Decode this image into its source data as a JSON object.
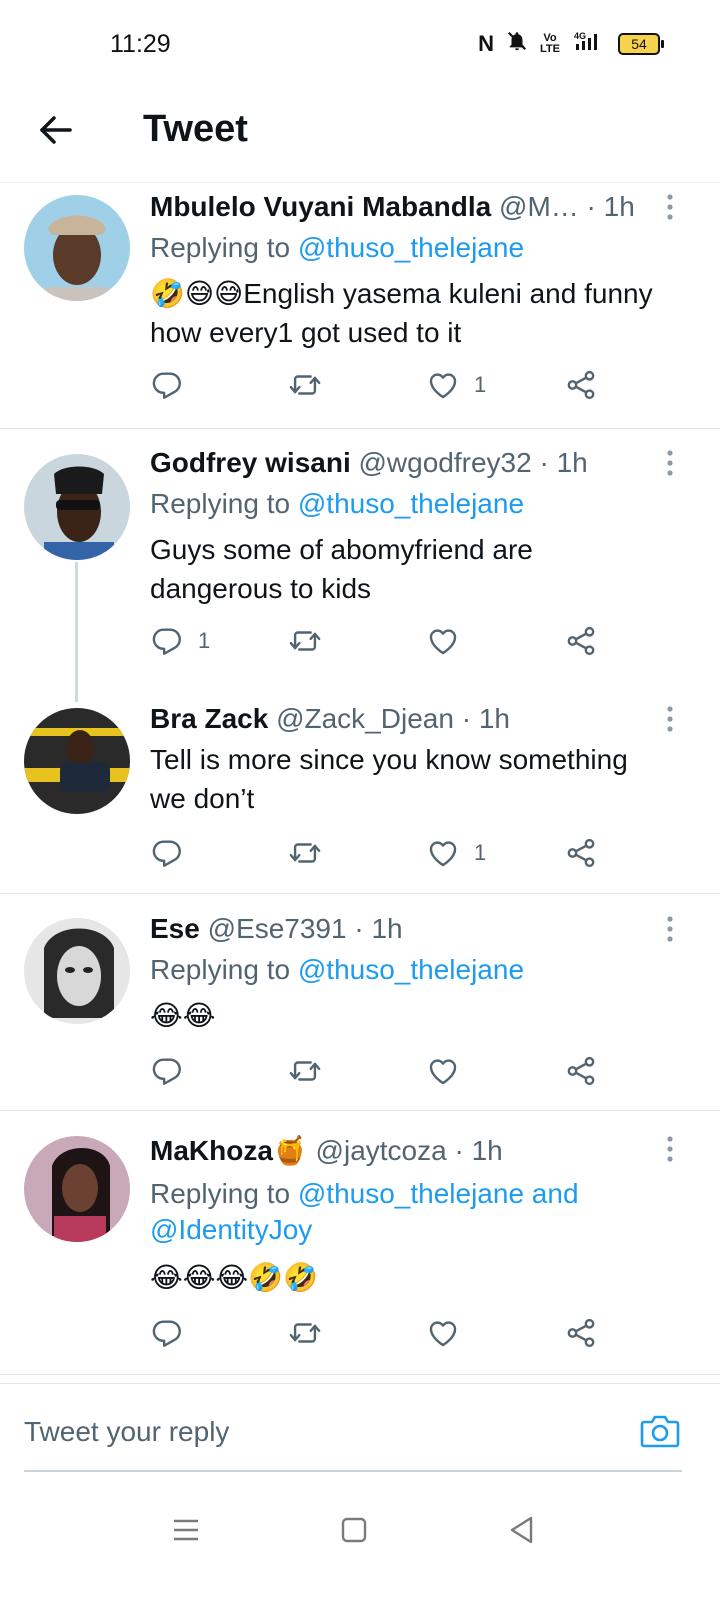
{
  "status": {
    "time": "11:29",
    "nfc": "N",
    "volte": "Vo\nLTE",
    "network": "4G",
    "battery": "54"
  },
  "header": {
    "title": "Tweet"
  },
  "tweets": [
    {
      "name": "Mbulelo Vuyani Mabandla",
      "handle": "@M…",
      "time": "1h",
      "replying_label": "Replying to",
      "mentions": "@thuso_thelejane",
      "text": "🤣😅😅English yasema kuleni and funny how every1 got used to it",
      "reply_count": "",
      "like_count": "1"
    },
    {
      "name": "Godfrey wisani",
      "handle": "@wgodfrey32",
      "time": "1h",
      "replying_label": "Replying to",
      "mentions": "@thuso_thelejane",
      "text": "Guys some of abomyfriend are dangerous to kids",
      "reply_count": "1",
      "like_count": ""
    },
    {
      "name": "Bra Zack",
      "handle": "@Zack_Djean",
      "time": "1h",
      "text": "Tell is more since you know something we don’t",
      "reply_count": "",
      "like_count": "1"
    },
    {
      "name": "Ese",
      "handle": "@Ese7391",
      "time": "1h",
      "replying_label": "Replying to",
      "mentions": "@thuso_thelejane",
      "text": "😂😂",
      "reply_count": "",
      "like_count": ""
    },
    {
      "name": "MaKhoza🍯",
      "handle": "@jaytcoza",
      "time": "1h",
      "replying_label": "Replying to",
      "mentions": "@thuso_thelejane and",
      "mentions2": "@IdentityJoy",
      "text": "😂😂😂🤣🤣",
      "reply_count": "",
      "like_count": ""
    }
  ],
  "reply_bar": {
    "placeholder": "Tweet your reply"
  },
  "colors": {
    "accent": "#1d9bf0",
    "muted": "#536471",
    "text": "#0f1419"
  }
}
